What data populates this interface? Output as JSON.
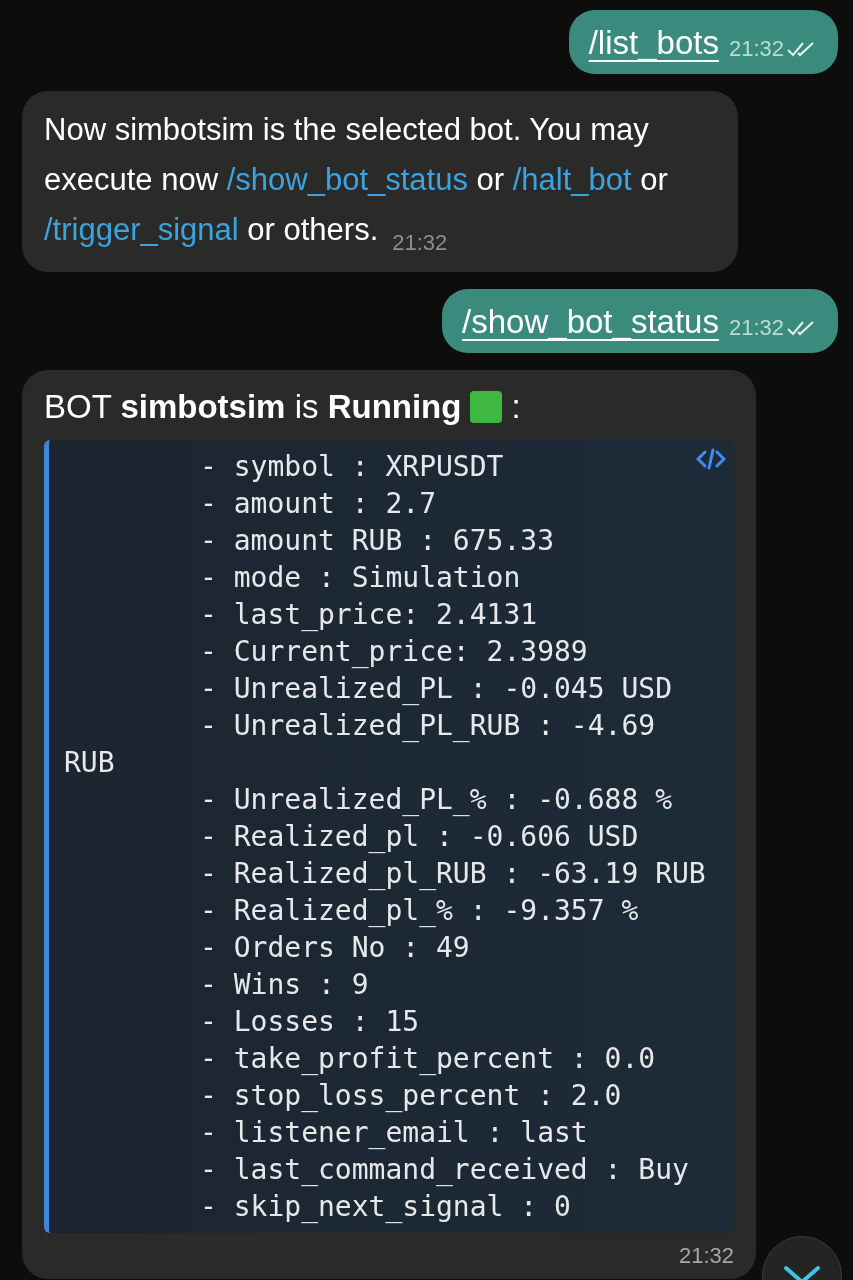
{
  "messages": [
    {
      "kind": "outgoing",
      "command": "/list_bots",
      "time": "21:32",
      "read": true
    },
    {
      "kind": "incoming",
      "segments": [
        {
          "kind": "text",
          "text": "Now simbotsim is the selected bot. You may execute now "
        },
        {
          "kind": "link",
          "text": "/show_bot_status"
        },
        {
          "kind": "text",
          "text": " or "
        },
        {
          "kind": "link",
          "text": "/halt_bot"
        },
        {
          "kind": "text",
          "text": " or "
        },
        {
          "kind": "link",
          "text": "/trigger_signal"
        },
        {
          "kind": "text",
          "text": " or others."
        }
      ],
      "time": "21:32"
    },
    {
      "kind": "outgoing",
      "command": "/show_bot_status",
      "time": "21:32",
      "read": true
    },
    {
      "kind": "status",
      "title": "BOT **simbotsim** is **Running**",
      "title_suffix": ":",
      "code_lines": [
        "- symbol : XRPUSDT",
        "- amount : 2.7",
        "- amount RUB : 675.33",
        "- mode : Simulation",
        "- last_price: 2.4131",
        "- Current_price: 2.3989",
        "- Unrealized_PL : -0.045 USD",
        "- Unrealized_PL_RUB : -4.69 RUB",
        "- Unrealized_PL_% : -0.688 %",
        "- Realized_pl : -0.606 USD",
        "- Realized_pl_RUB : -63.19 RUB",
        "- Realized_pl_% : -9.357 %",
        "- Orders No : 49",
        "- Wins : 9",
        "- Losses : 15",
        "- take_profit_percent : 0.0",
        "- stop_loss_percent : 2.0",
        "- listener_email : last",
        "- last_command_received : Buy",
        "- skip_next_signal : 0"
      ],
      "time": "21:32"
    }
  ]
}
